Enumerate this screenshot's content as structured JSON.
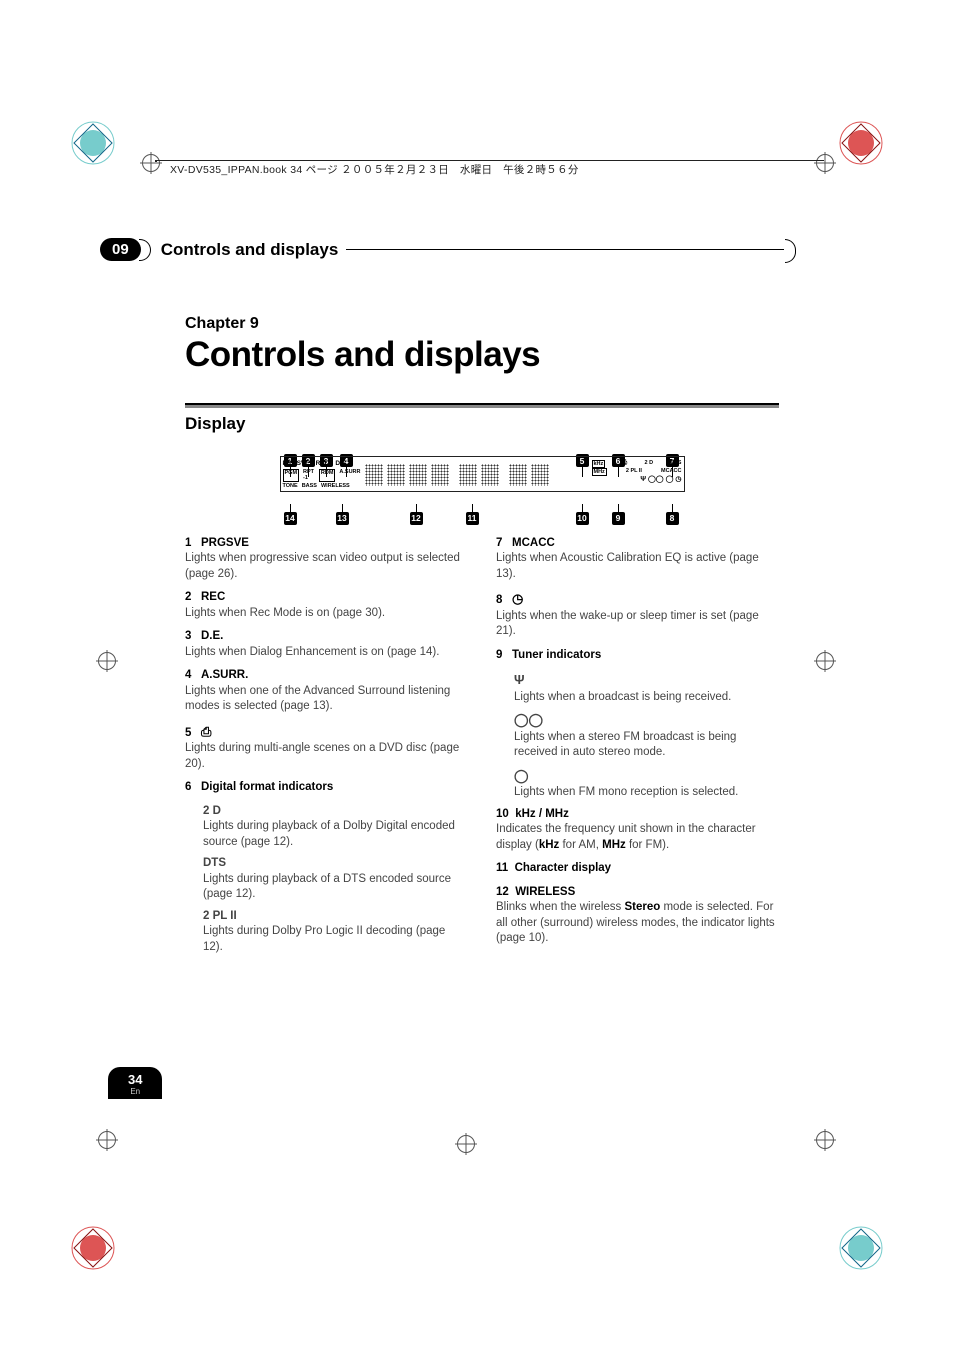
{
  "book_header": "XV-DV535_IPPAN.book 34 ページ ２００５年２月２３日　水曜日　午後２時５６分",
  "header": {
    "num": "09",
    "title": "Controls and displays"
  },
  "chapter": {
    "label": "Chapter 9",
    "title": "Controls and displays"
  },
  "section": "Display",
  "callouts_top": [
    "1",
    "2",
    "3",
    "4",
    "5",
    "6",
    "7"
  ],
  "callouts_bot": [
    "14",
    "13",
    "12",
    "11",
    "10",
    "9",
    "8"
  ],
  "disp_row1": [
    "PRGSVE",
    "REC",
    "D.E."
  ],
  "disp_row2": [
    "PGM",
    "RPT -1",
    "RDM",
    "A.SURR"
  ],
  "disp_row3": [
    "TONE",
    "BASS",
    "WIRELESS"
  ],
  "disp_right1": [
    "2 D",
    "DTS"
  ],
  "disp_right2": [
    "2 PL II",
    "MCACC"
  ],
  "disp_rbelow": [
    "kHz",
    "MHz"
  ],
  "left_items": [
    {
      "n": "1",
      "t": "PRGSVE",
      "d": "Lights when progressive scan video output is selected (page 26)."
    },
    {
      "n": "2",
      "t": "REC",
      "d": "Lights when Rec Mode is on (page 30)."
    },
    {
      "n": "3",
      "t": "D.E.",
      "d": "Lights when Dialog Enhancement is on (page 14)."
    },
    {
      "n": "4",
      "t": "A.SURR.",
      "d": "Lights when one of the Advanced Surround listening modes is selected (page 13)."
    },
    {
      "n": "5",
      "t": "",
      "icon": "camera",
      "d": "Lights during multi-angle scenes on a DVD disc (page 20)."
    },
    {
      "n": "6",
      "t": "Digital format indicators",
      "d": ""
    }
  ],
  "left_subs": [
    {
      "t": "2 D",
      "d": "Lights during playback of a Dolby Digital encoded source (page 12)."
    },
    {
      "t": "DTS",
      "d": "Lights during playback of a DTS encoded source (page 12)."
    },
    {
      "t": "2 PL II",
      "d": "Lights during Dolby Pro Logic II decoding (page 12)."
    }
  ],
  "right_items": [
    {
      "n": "7",
      "t": "MCACC",
      "d": "Lights when Acoustic Calibration EQ is active (page 13)."
    },
    {
      "n": "8",
      "t": "",
      "icon": "clock",
      "d": "Lights when the wake-up or sleep timer is set (page 21)."
    },
    {
      "n": "9",
      "t": "Tuner indicators",
      "d": ""
    }
  ],
  "right_subs": [
    {
      "icon": "antenna",
      "d": "Lights when a broadcast is being received."
    },
    {
      "icon": "stereo",
      "d": "Lights when a stereo FM broadcast is being received in auto stereo mode."
    },
    {
      "icon": "mono",
      "d": "Lights when FM mono reception is selected."
    }
  ],
  "right_items2": [
    {
      "n": "10",
      "t": "kHz / MHz",
      "d": "Indicates the frequency unit shown in the character display (",
      "b1": "kHz",
      "mid": " for AM, ",
      "b2": "MHz",
      "end": " for FM)."
    },
    {
      "n": "11",
      "t": "Character display",
      "d": ""
    },
    {
      "n": "12",
      "t": "WIRELESS",
      "d": "Blinks when the wireless ",
      "b1": "Stereo",
      "end": " mode is selected. For all other (surround) wireless modes, the indicator lights (page 10)."
    }
  ],
  "page_num": "34",
  "page_lang": "En"
}
